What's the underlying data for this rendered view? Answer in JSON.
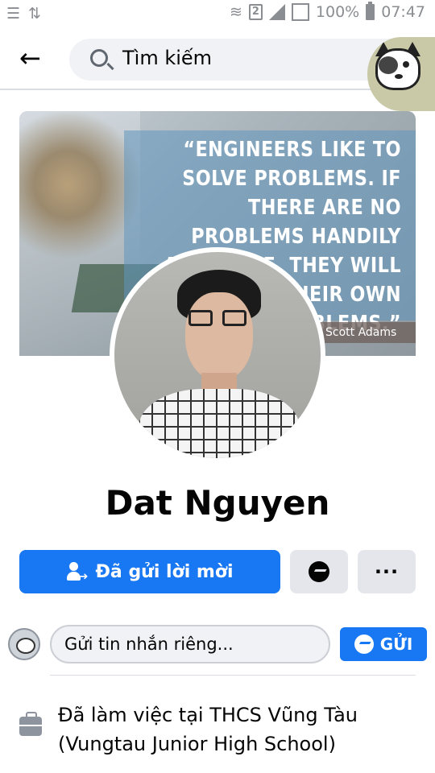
{
  "status_bar": {
    "sim_slot": "2",
    "battery": "100%",
    "time": "07:47"
  },
  "search": {
    "placeholder": "Tìm kiếm"
  },
  "cover": {
    "quote": "“ENGINEERS LIKE TO SOLVE PROBLEMS. IF THERE ARE NO PROBLEMS HANDILY AVAILABLE, THEY WILL CREATE THEIR OWN PROBLEMS.”",
    "author": "Scott Adams"
  },
  "profile": {
    "name": "Dat Nguyen"
  },
  "actions": {
    "friend_request_label": "Đã gửi lời mời",
    "more_label": "···"
  },
  "composer": {
    "placeholder": "Gửi tin nhắn riêng...",
    "send_label": "GỬI"
  },
  "work": {
    "text": "Đã làm việc tại THCS Vũng Tàu (Vungtau Junior High School)"
  },
  "colors": {
    "primary": "#1877f2",
    "secondary_button": "#e4e6eb",
    "icon_grey": "#8d949e"
  }
}
